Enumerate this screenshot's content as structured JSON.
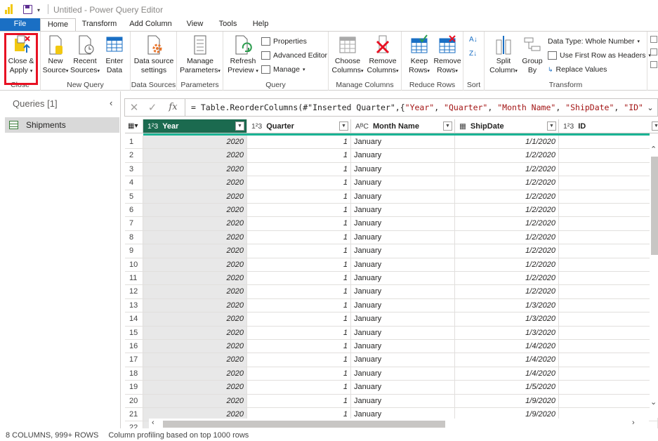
{
  "window": {
    "title": "Untitled - Power Query Editor"
  },
  "tabs": [
    "File",
    "Home",
    "Transform",
    "Add Column",
    "View",
    "Tools",
    "Help"
  ],
  "ribbon": {
    "close_group": {
      "label": "Close",
      "close_apply": "Close &",
      "close_apply2": "Apply"
    },
    "new_query_group": {
      "label": "New Query",
      "new_source": "New",
      "new_source2": "Source",
      "recent_sources": "Recent",
      "recent_sources2": "Sources",
      "enter_data": "Enter",
      "enter_data2": "Data"
    },
    "data_sources_group": {
      "label": "Data Sources",
      "ds_settings": "Data source",
      "ds_settings2": "settings"
    },
    "parameters_group": {
      "label": "Parameters",
      "manage_params": "Manage",
      "manage_params2": "Parameters"
    },
    "query_group": {
      "label": "Query",
      "refresh": "Refresh",
      "refresh2": "Preview",
      "properties": "Properties",
      "advanced_editor": "Advanced Editor",
      "manage": "Manage"
    },
    "manage_columns_group": {
      "label": "Manage Columns",
      "choose": "Choose",
      "choose2": "Columns",
      "remove": "Remove",
      "remove2": "Columns"
    },
    "reduce_rows_group": {
      "label": "Reduce Rows",
      "keep": "Keep",
      "keep2": "Rows",
      "remove_rows": "Remove",
      "remove_rows2": "Rows"
    },
    "sort_group": {
      "label": "Sort"
    },
    "transform_group": {
      "label": "Transform",
      "split": "Split",
      "split2": "Column",
      "group": "Group",
      "group2": "By",
      "data_type": "Data Type: Whole Number",
      "first_row": "Use First Row as Headers",
      "replace": "Replace Values"
    }
  },
  "queries": {
    "title": "Queries [1]",
    "items": [
      "Shipments"
    ]
  },
  "formula": {
    "prefix": "= Table.ReorderColumns(#\"Inserted Quarter\",{",
    "s1": "\"Year\"",
    "s2": "\"Quarter\"",
    "s3": "\"Month Name\"",
    "s4": "\"ShipDate\"",
    "s5": "\"ID\"",
    "sep": ", ",
    "tail": ","
  },
  "columns": [
    {
      "type": "1²3",
      "name": "Year"
    },
    {
      "type": "1²3",
      "name": "Quarter"
    },
    {
      "type": "AᴮC",
      "name": "Month Name"
    },
    {
      "type": "▦",
      "name": "ShipDate"
    },
    {
      "type": "1²3",
      "name": "ID"
    }
  ],
  "rows": [
    [
      "1",
      "2020",
      "1",
      "January",
      "1/1/2020"
    ],
    [
      "2",
      "2020",
      "1",
      "January",
      "1/2/2020"
    ],
    [
      "3",
      "2020",
      "1",
      "January",
      "1/2/2020"
    ],
    [
      "4",
      "2020",
      "1",
      "January",
      "1/2/2020"
    ],
    [
      "5",
      "2020",
      "1",
      "January",
      "1/2/2020"
    ],
    [
      "6",
      "2020",
      "1",
      "January",
      "1/2/2020"
    ],
    [
      "7",
      "2020",
      "1",
      "January",
      "1/2/2020"
    ],
    [
      "8",
      "2020",
      "1",
      "January",
      "1/2/2020"
    ],
    [
      "9",
      "2020",
      "1",
      "January",
      "1/2/2020"
    ],
    [
      "10",
      "2020",
      "1",
      "January",
      "1/2/2020"
    ],
    [
      "11",
      "2020",
      "1",
      "January",
      "1/2/2020"
    ],
    [
      "12",
      "2020",
      "1",
      "January",
      "1/2/2020"
    ],
    [
      "13",
      "2020",
      "1",
      "January",
      "1/3/2020"
    ],
    [
      "14",
      "2020",
      "1",
      "January",
      "1/3/2020"
    ],
    [
      "15",
      "2020",
      "1",
      "January",
      "1/3/2020"
    ],
    [
      "16",
      "2020",
      "1",
      "January",
      "1/4/2020"
    ],
    [
      "17",
      "2020",
      "1",
      "January",
      "1/4/2020"
    ],
    [
      "18",
      "2020",
      "1",
      "January",
      "1/4/2020"
    ],
    [
      "19",
      "2020",
      "1",
      "January",
      "1/5/2020"
    ],
    [
      "20",
      "2020",
      "1",
      "January",
      "1/9/2020"
    ],
    [
      "21",
      "2020",
      "1",
      "January",
      "1/9/2020"
    ],
    [
      "22",
      "",
      "",
      "",
      ""
    ]
  ],
  "status": {
    "counts": "8 COLUMNS, 999+ ROWS",
    "profiling": "Column profiling based on top 1000 rows"
  },
  "colors": {
    "accent": "#1a6fc4",
    "selected_header": "#1b6a4f",
    "highlight": "#e81123",
    "quality": "#1ab394"
  }
}
